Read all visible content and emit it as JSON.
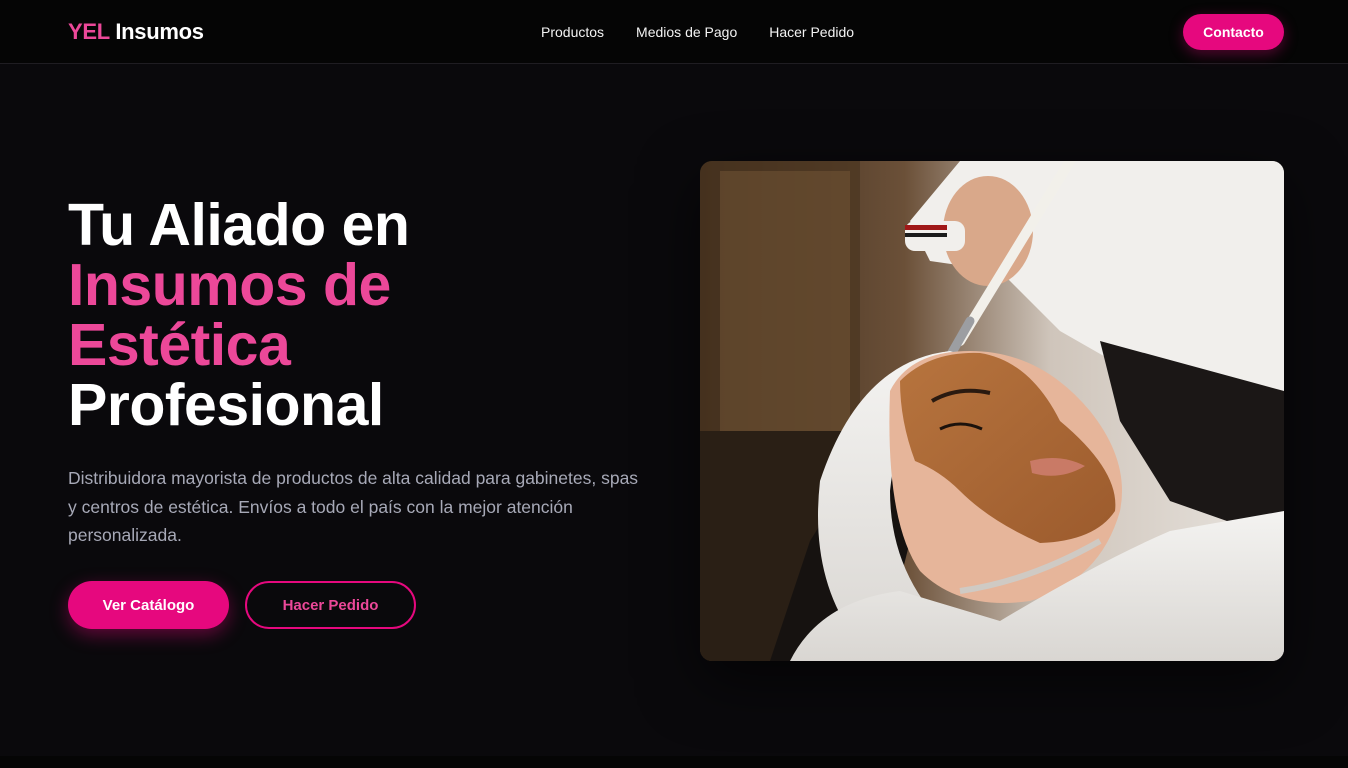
{
  "brand": {
    "accent": "YEL",
    "name": "Insumos"
  },
  "nav": {
    "links": [
      "Productos",
      "Medios de Pago",
      "Hacer Pedido"
    ],
    "contact_label": "Contacto"
  },
  "hero": {
    "title_line_1": "Tu Aliado en",
    "title_line_2": "Insumos de",
    "title_line_3": "Estética",
    "title_line_4": "Profesional",
    "description": "Distribuidora mayorista de productos de alta calidad para gabinetes, spas y centros de estética. Envíos a todo el país con la mejor atención personalizada.",
    "primary_cta": "Ver Catálogo",
    "secondary_cta": "Hacer Pedido"
  },
  "colors": {
    "accent": "#e6087e",
    "accent_text": "#ec4899",
    "background": "#0a090c",
    "navbar": "#050505",
    "muted_text": "#a7a9b7"
  }
}
